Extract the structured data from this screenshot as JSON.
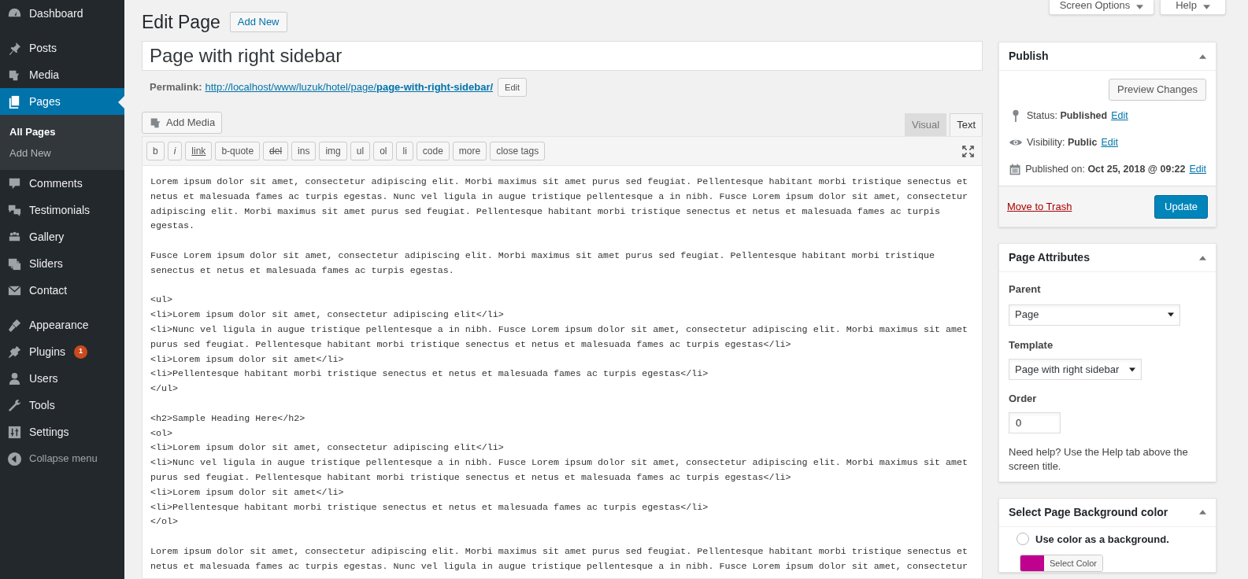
{
  "sidebar": {
    "groups": [
      [
        {
          "label": "Dashboard",
          "selected": false
        }
      ],
      [
        {
          "label": "Posts",
          "selected": false
        },
        {
          "label": "Media",
          "selected": false
        },
        {
          "label": "Pages",
          "selected": true,
          "children": [
            {
              "label": "All Pages",
              "selected": true
            },
            {
              "label": "Add New",
              "selected": false
            }
          ]
        },
        {
          "label": "Comments",
          "selected": false
        },
        {
          "label": "Testimonials",
          "selected": false
        },
        {
          "label": "Gallery",
          "selected": false
        },
        {
          "label": "Sliders",
          "selected": false
        },
        {
          "label": "Contact",
          "selected": false
        }
      ],
      [
        {
          "label": "Appearance",
          "selected": false
        },
        {
          "label": "Plugins",
          "selected": false,
          "badge": "1"
        },
        {
          "label": "Users",
          "selected": false
        },
        {
          "label": "Tools",
          "selected": false
        },
        {
          "label": "Settings",
          "selected": false
        }
      ]
    ],
    "collapse": "Collapse menu"
  },
  "top_buttons": [
    "Screen Options",
    "Help"
  ],
  "heading": "Edit Page",
  "add_new": "Add New",
  "title_field": "Page with right sidebar",
  "permalink": {
    "label": "Permalink:",
    "base": "http://localhost/www/luzuk/hotel/page/",
    "slug": "page-with-right-sidebar/",
    "edit": "Edit"
  },
  "add_media": "Add Media",
  "editor_tabs": [
    {
      "label": "Visual",
      "selected": false
    },
    {
      "label": "Text",
      "selected": true
    }
  ],
  "quicktags": [
    {
      "label": "b",
      "kind": "plain"
    },
    {
      "label": "i",
      "kind": "italic"
    },
    {
      "label": "link",
      "kind": "underline"
    },
    {
      "label": "b-quote",
      "kind": "plain"
    },
    {
      "label": "del",
      "kind": "strike"
    },
    {
      "label": "ins",
      "kind": "plain"
    },
    {
      "label": "img",
      "kind": "plain"
    },
    {
      "label": "ul",
      "kind": "plain"
    },
    {
      "label": "ol",
      "kind": "plain"
    },
    {
      "label": "li",
      "kind": "plain"
    },
    {
      "label": "code",
      "kind": "plain"
    },
    {
      "label": "more",
      "kind": "plain"
    },
    {
      "label": "close tags",
      "kind": "plain"
    }
  ],
  "editor": {
    "blocks": [
      [
        "Lorem ipsum dolor sit amet, consectetur adipiscing elit. Morbi maximus sit amet purus sed feugiat. Pellentesque habitant morbi tristique senectus et",
        "netus et malesuada fames ac turpis egestas. Nunc vel ligula in augue tristique pellentesque a in nibh. Fusce Lorem ipsum dolor sit amet, consectetur",
        "adipiscing elit. Morbi maximus sit amet purus sed feugiat. Pellentesque habitant morbi tristique senectus et netus et malesuada fames ac turpis",
        "egestas."
      ],
      [
        "Fusce Lorem ipsum dolor sit amet, consectetur adipiscing elit. Morbi maximus sit amet purus sed feugiat. Pellentesque habitant morbi tristique",
        "senectus et netus et malesuada fames ac turpis egestas."
      ],
      [
        "<ul>",
        "<li>Lorem ipsum dolor sit amet, consectetur adipiscing elit</li>",
        "<li>Nunc vel ligula in augue tristique pellentesque a in nibh. Fusce Lorem ipsum dolor sit amet, consectetur adipiscing elit. Morbi maximus sit amet",
        "purus sed feugiat. Pellentesque habitant morbi tristique senectus et netus et malesuada fames ac turpis egestas</li>",
        "<li>Lorem ipsum dolor sit amet</li>",
        "<li>Pellentesque habitant morbi tristique senectus et netus et malesuada fames ac turpis egestas</li>",
        "</ul>"
      ],
      [
        "<h2>Sample Heading Here</h2>",
        "<ol>",
        "<li>Lorem ipsum dolor sit amet, consectetur adipiscing elit</li>",
        "<li>Nunc vel ligula in augue tristique pellentesque a in nibh. Fusce Lorem ipsum dolor sit amet, consectetur adipiscing elit. Morbi maximus sit amet",
        "purus sed feugiat. Pellentesque habitant morbi tristique senectus et netus et malesuada fames ac turpis egestas</li>",
        "<li>Lorem ipsum dolor sit amet</li>",
        "<li>Pellentesque habitant morbi tristique senectus et netus et malesuada fames ac turpis egestas</li>",
        "</ol>"
      ],
      [
        "Lorem ipsum dolor sit amet, consectetur adipiscing elit. Morbi maximus sit amet purus sed feugiat. Pellentesque habitant morbi tristique senectus et",
        "netus et malesuada fames ac turpis egestas. Nunc vel ligula in augue tristique pellentesque a in nibh. Fusce Lorem ipsum dolor sit amet, consectetur"
      ]
    ]
  },
  "publish": {
    "title": "Publish",
    "preview": "Preview Changes",
    "rows": [
      {
        "kind": "status",
        "label": "Status:",
        "value": "Published",
        "link": "Edit"
      },
      {
        "kind": "visibility",
        "label": "Visibility:",
        "value": "Public",
        "link": "Edit"
      },
      {
        "kind": "date",
        "label": "Published on:",
        "value": "Oct 25, 2018 @ 09:22",
        "link": "Edit"
      }
    ],
    "trash": "Move to Trash",
    "update": "Update"
  },
  "attributes": {
    "title": "Page Attributes",
    "parent_label": "Parent",
    "parent": "Page",
    "template_label": "Template",
    "template": "Page with right sidebar",
    "order_label": "Order",
    "order": "0",
    "help": "Need help? Use the Help tab above the screen title."
  },
  "background": {
    "title": "Select Page Background color",
    "use_color": {
      "label": "Use color as a background.",
      "checked": false
    },
    "color": "#c0008f",
    "button": "Select Color"
  }
}
